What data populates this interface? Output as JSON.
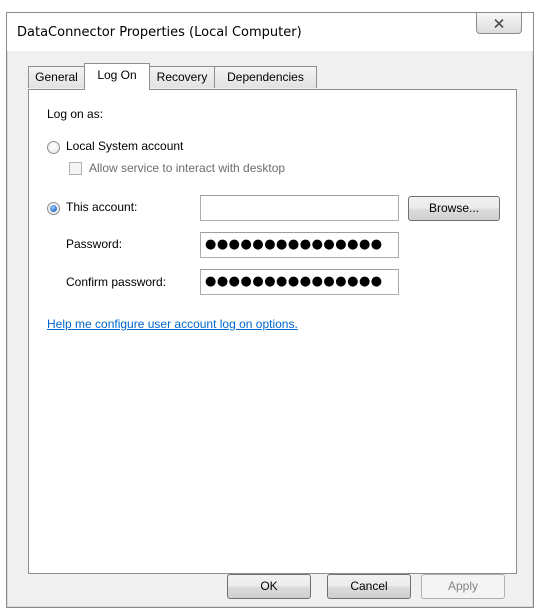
{
  "window": {
    "title": "DataConnector Properties (Local Computer)"
  },
  "tabs": [
    {
      "label": "General"
    },
    {
      "label": "Log On"
    },
    {
      "label": "Recovery"
    },
    {
      "label": "Dependencies"
    }
  ],
  "active_tab": "Log On",
  "logon": {
    "heading": "Log on as:",
    "local_system_label": "Local System account",
    "local_system_selected": false,
    "interact_label": "Allow service to interact with desktop",
    "interact_checked": false,
    "this_account_label": "This account:",
    "this_account_selected": true,
    "account_value": "",
    "browse_label": "Browse...",
    "password_label": "Password:",
    "password_value": "●●●●●●●●●●●●●●●",
    "confirm_label": "Confirm password:",
    "confirm_value": "●●●●●●●●●●●●●●●",
    "help_link": "Help me configure user account log on options."
  },
  "footer": {
    "ok": "OK",
    "cancel": "Cancel",
    "apply": "Apply"
  },
  "colors": {
    "link": "#0066cc",
    "radio_fill": "#1d5fbf"
  },
  "icons": {
    "close": "close-icon"
  }
}
